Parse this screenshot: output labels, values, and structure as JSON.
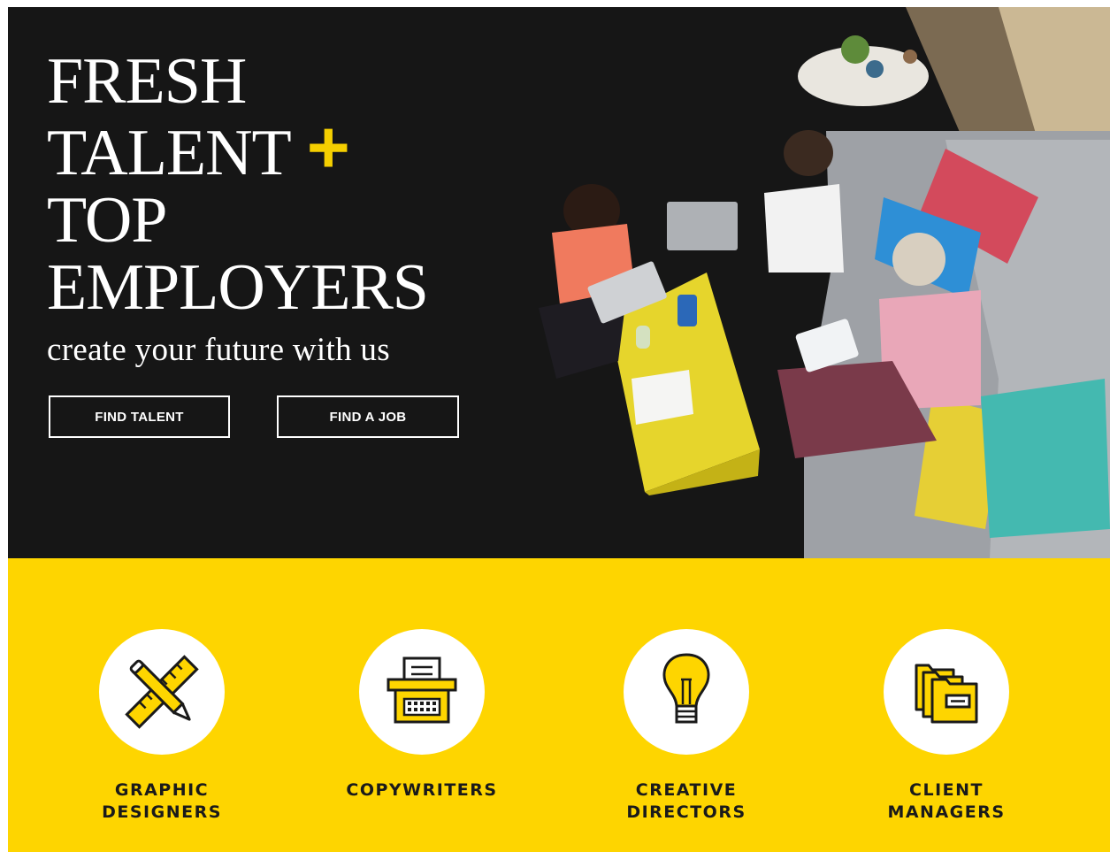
{
  "hero": {
    "headline_line1": "FRESH",
    "headline_line2": "TALENT",
    "plus_symbol": "+",
    "headline_line3": "TOP",
    "headline_line4": "EMPLOYERS",
    "tagline": "create your future with us",
    "accent_color": "#f5cf00"
  },
  "buttons": {
    "find_talent": "FIND TALENT",
    "find_job": "FIND A JOB"
  },
  "categories": {
    "background_color": "#fed500",
    "items": [
      {
        "label": "GRAPHIC\nDESIGNERS",
        "icon": "pencil-ruler-icon"
      },
      {
        "label": "COPYWRITERS",
        "icon": "typewriter-icon"
      },
      {
        "label": "CREATIVE\nDIRECTORS",
        "icon": "lightbulb-icon"
      },
      {
        "label": "CLIENT\nMANAGERS",
        "icon": "folders-icon"
      }
    ]
  }
}
